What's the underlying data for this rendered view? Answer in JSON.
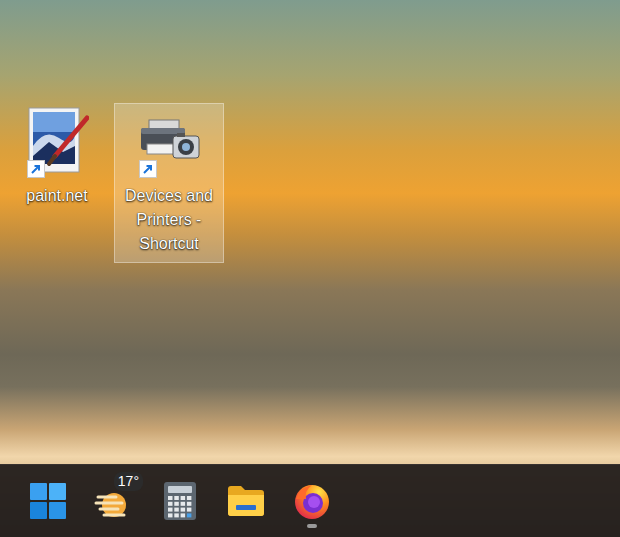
{
  "desktop": {
    "icons": [
      {
        "label": "paint.net",
        "kind": "paintnet",
        "shortcut": true,
        "selected": false
      },
      {
        "label": "Devices and Printers - Shortcut",
        "kind": "printers",
        "shortcut": true,
        "selected": true
      }
    ]
  },
  "taskbar": {
    "items": [
      {
        "kind": "start",
        "badge": "",
        "running": false
      },
      {
        "kind": "weather",
        "badge": "17°",
        "running": false
      },
      {
        "kind": "calculator",
        "badge": "",
        "running": false
      },
      {
        "kind": "explorer",
        "badge": "",
        "running": false
      },
      {
        "kind": "firefox",
        "badge": "",
        "running": true
      }
    ]
  }
}
